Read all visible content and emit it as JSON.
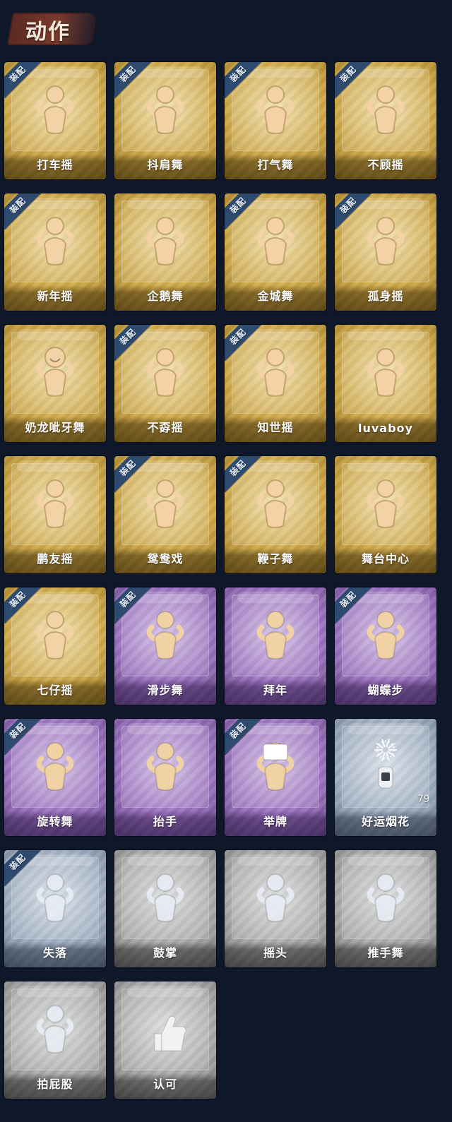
{
  "header": {
    "title": "动作"
  },
  "colors": {
    "background": "#0f1829",
    "tier_gold": "#cfa948",
    "tier_purple": "#9a72bf",
    "tier_blue": "#9eadc0",
    "tier_gray": "#aaaaaa",
    "equipped_ribbon": "#2e4b6f"
  },
  "cards": [
    {
      "name": "打车摇",
      "tier": "gold",
      "equipped": true,
      "equip_label": "装配",
      "icon": "pose-dance-icon"
    },
    {
      "name": "抖肩舞",
      "tier": "gold",
      "equipped": true,
      "equip_label": "装配",
      "icon": "pose-dance-icon"
    },
    {
      "name": "打气舞",
      "tier": "gold",
      "equipped": true,
      "equip_label": "装配",
      "icon": "pose-dance-icon"
    },
    {
      "name": "不顾摇",
      "tier": "gold",
      "equipped": true,
      "equip_label": "装配",
      "icon": "pose-dance-icon"
    },
    {
      "name": "新年摇",
      "tier": "gold",
      "equipped": true,
      "equip_label": "装配",
      "icon": "pose-dance-icon"
    },
    {
      "name": "企鹅舞",
      "tier": "gold",
      "equipped": false,
      "icon": "pose-dance-icon"
    },
    {
      "name": "金城舞",
      "tier": "gold",
      "equipped": true,
      "equip_label": "装配",
      "icon": "pose-dance-icon"
    },
    {
      "name": "孤身摇",
      "tier": "gold",
      "equipped": true,
      "equip_label": "装配",
      "icon": "pose-dance-icon"
    },
    {
      "name": "奶龙呲牙舞",
      "tier": "gold",
      "equipped": false,
      "icon": "grin-dance-icon"
    },
    {
      "name": "不孬摇",
      "tier": "gold",
      "equipped": true,
      "equip_label": "装配",
      "icon": "pose-dance-icon"
    },
    {
      "name": "知世摇",
      "tier": "gold",
      "equipped": true,
      "equip_label": "装配",
      "icon": "pose-dance-icon"
    },
    {
      "name": "luvaboy",
      "tier": "gold",
      "equipped": false,
      "icon": "pose-dance-icon"
    },
    {
      "name": "鹏友摇",
      "tier": "gold",
      "equipped": false,
      "icon": "pose-dance-icon"
    },
    {
      "name": "鸳鸯戏",
      "tier": "gold",
      "equipped": true,
      "equip_label": "装配",
      "icon": "pose-dance-icon"
    },
    {
      "name": "鞭子舞",
      "tier": "gold",
      "equipped": true,
      "equip_label": "装配",
      "icon": "pose-dance-icon"
    },
    {
      "name": "舞台中心",
      "tier": "gold",
      "equipped": false,
      "icon": "pose-dance-icon"
    },
    {
      "name": "七仔摇",
      "tier": "gold",
      "equipped": true,
      "equip_label": "装配",
      "icon": "pose-dance-icon"
    },
    {
      "name": "滑步舞",
      "tier": "purple",
      "equipped": true,
      "equip_label": "装配",
      "icon": "pose-dance-icon"
    },
    {
      "name": "拜年",
      "tier": "purple",
      "equipped": false,
      "icon": "pose-greet-icon"
    },
    {
      "name": "蝴蝶步",
      "tier": "purple",
      "equipped": true,
      "equip_label": "装配",
      "icon": "pose-dance-icon"
    },
    {
      "name": "旋转舞",
      "tier": "purple",
      "equipped": true,
      "equip_label": "装配",
      "icon": "spin-dance-icon"
    },
    {
      "name": "抬手",
      "tier": "purple",
      "equipped": false,
      "icon": "raise-hand-icon"
    },
    {
      "name": "举牌",
      "tier": "purple",
      "equipped": true,
      "equip_label": "装配",
      "icon": "sign-hold-icon"
    },
    {
      "name": "好运烟花",
      "tier": "blue",
      "equipped": false,
      "count": "79",
      "icon": "firework-icon"
    },
    {
      "name": "失落",
      "tier": "blue",
      "equipped": true,
      "equip_label": "装配",
      "icon": "kneel-icon"
    },
    {
      "name": "鼓掌",
      "tier": "gray",
      "equipped": false,
      "icon": "clap-icon"
    },
    {
      "name": "摇头",
      "tier": "gray",
      "equipped": false,
      "icon": "shake-head-icon"
    },
    {
      "name": "推手舞",
      "tier": "gray",
      "equipped": false,
      "icon": "push-dance-icon"
    },
    {
      "name": "拍屁股",
      "tier": "gray",
      "equipped": false,
      "icon": "butt-slap-icon"
    },
    {
      "name": "认可",
      "tier": "gray",
      "equipped": false,
      "icon": "thumbs-up-icon"
    }
  ]
}
